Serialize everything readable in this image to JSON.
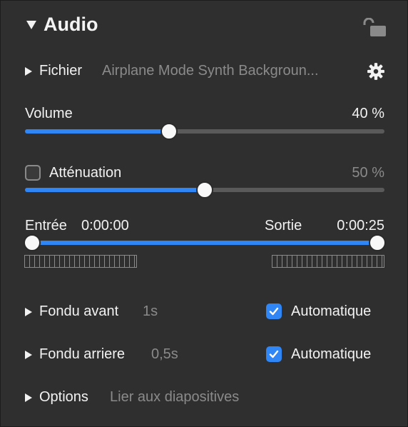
{
  "header": {
    "title": "Audio"
  },
  "file": {
    "label": "Fichier",
    "value": "Airplane Mode Synth Backgroun..."
  },
  "volume": {
    "label": "Volume",
    "value_text": "40 %",
    "percent": 0.4
  },
  "attenuation": {
    "label": "Atténuation",
    "value_text": "50 %",
    "percent": 0.5,
    "checked": false
  },
  "trim": {
    "start_label": "Entrée",
    "start_value": "0:00:00",
    "end_label": "Sortie",
    "end_value": "0:00:25",
    "start_fraction": 0.0,
    "end_fraction": 1.0
  },
  "fade_in": {
    "label": "Fondu avant",
    "value": "1s",
    "auto_label": "Automatique",
    "auto_checked": true
  },
  "fade_out": {
    "label": "Fondu arriere",
    "value": "0,5s",
    "auto_label": "Automatique",
    "auto_checked": true
  },
  "options": {
    "label": "Options",
    "value": "Lier aux diapositives"
  },
  "colors": {
    "accent": "#2f86f4",
    "panel": "#2f2f2f"
  },
  "icons": {
    "lock": "unlocked-lock-icon",
    "settings": "gear-icon"
  }
}
